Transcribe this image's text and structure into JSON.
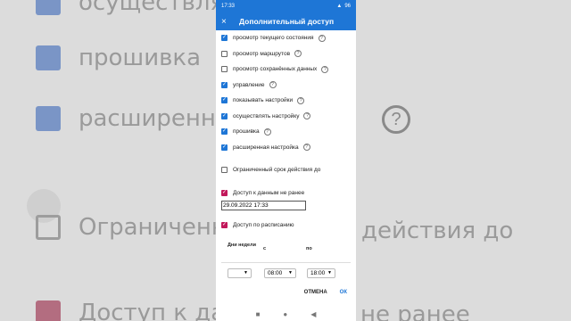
{
  "background": {
    "items": [
      {
        "label": "осуществля",
        "box": "blue"
      },
      {
        "label": "прошивка",
        "box": "blue"
      },
      {
        "label": "расширенна",
        "box": "blue"
      },
      {
        "label": "Ограниченн",
        "box": "empty",
        "suffix": "действия до"
      },
      {
        "label": "Доступ к дан",
        "box": "red",
        "suffix": "не ранее"
      }
    ],
    "help_symbol": "?"
  },
  "statusbar": {
    "time": "17:33",
    "battery": "96"
  },
  "appbar": {
    "close_icon": "×",
    "title": "Дополнительный доступ"
  },
  "permissions": [
    {
      "label": "просмотр текущего состояния",
      "checked": true
    },
    {
      "label": "просмотр маршрутов",
      "checked": false
    },
    {
      "label": "просмотр сохранённых данных",
      "checked": false
    },
    {
      "label": "управление",
      "checked": true
    },
    {
      "label": "показывать настройки",
      "checked": true
    },
    {
      "label": "осуществлять настройку",
      "checked": true
    },
    {
      "label": "прошивка",
      "checked": true
    },
    {
      "label": "расширенная настройка",
      "checked": true
    }
  ],
  "limited_validity": {
    "label": "Ограниченный срок действия до",
    "checked": false
  },
  "access_not_before": {
    "label": "Доступ к данным не ранее",
    "checked": true,
    "value": "29.09.2022 17:33"
  },
  "schedule_access": {
    "label": "Доступ по расписанию",
    "checked": true
  },
  "schedule": {
    "col_day": "Дни недели",
    "col_from": "с",
    "col_to": "по",
    "day_value": "",
    "from_value": "08:00",
    "to_value": "18:00"
  },
  "buttons": {
    "cancel": "ОТМЕНА",
    "ok": "ОК"
  },
  "nav": {
    "recents": "■",
    "home": "●",
    "back": "◀"
  },
  "colors": {
    "primary": "#1e76d6",
    "accent_red": "#c2185b"
  }
}
